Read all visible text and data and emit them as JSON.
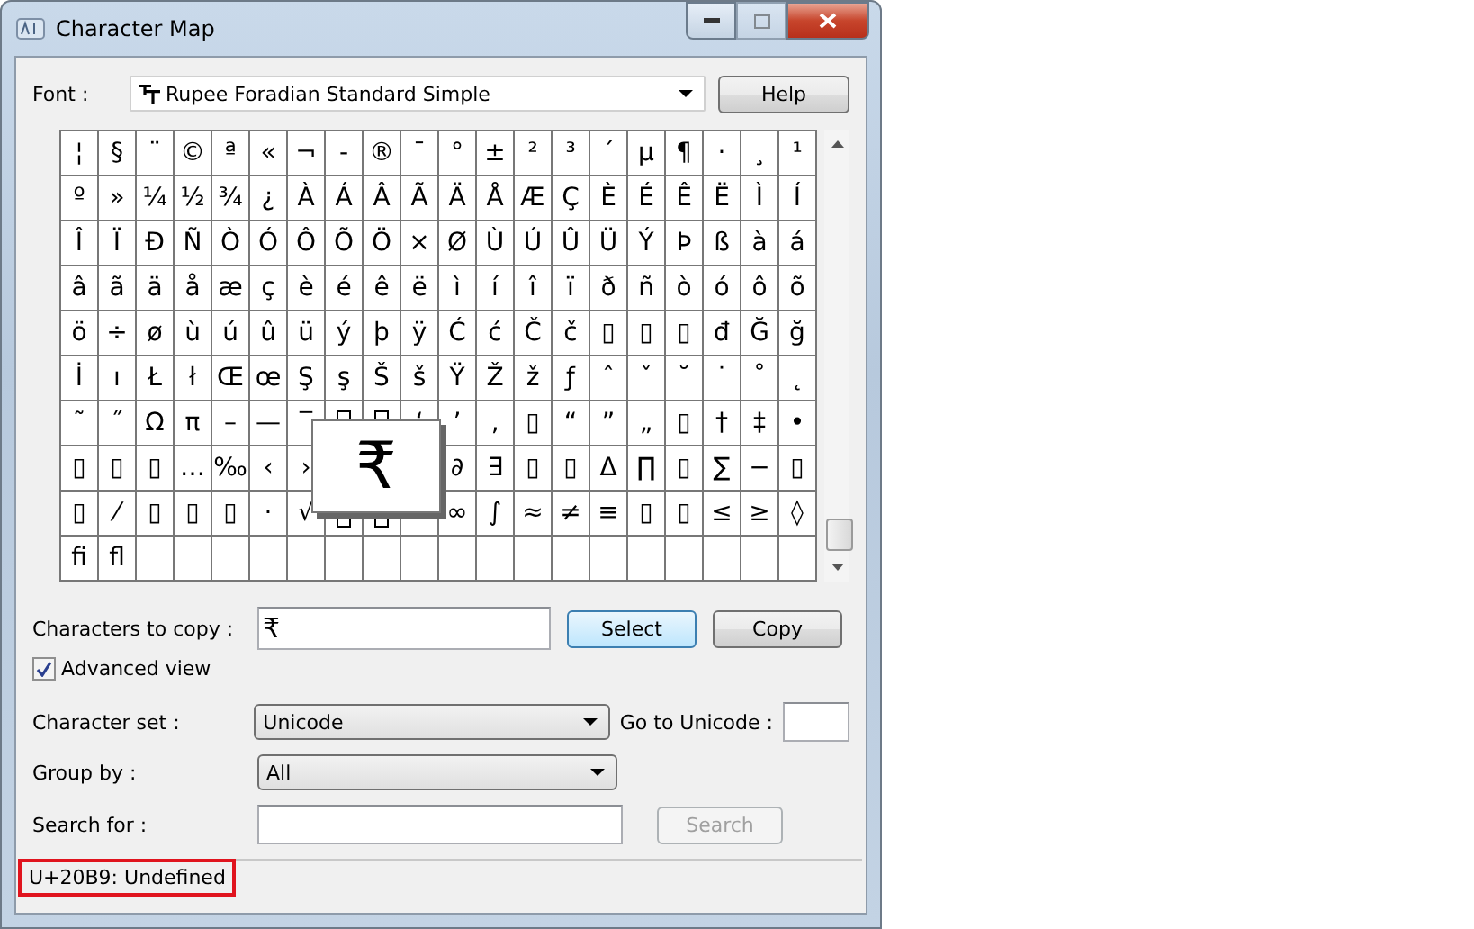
{
  "window": {
    "title": "Character Map",
    "maximize_disabled": true
  },
  "font": {
    "label": "Font :",
    "value": "Rupee Foradian Standard Simple"
  },
  "help_button": "Help",
  "grid": [
    [
      "¦",
      "§",
      "¨",
      "©",
      "ª",
      "«",
      "¬",
      "-",
      "®",
      "¯",
      "°",
      "±",
      "²",
      "³",
      "´",
      "µ",
      "¶",
      "·",
      "¸",
      "¹"
    ],
    [
      "º",
      "»",
      "¼",
      "½",
      "¾",
      "¿",
      "À",
      "Á",
      "Â",
      "Ã",
      "Ä",
      "Å",
      "Æ",
      "Ç",
      "È",
      "É",
      "Ê",
      "Ë",
      "Ì",
      "Í"
    ],
    [
      "Î",
      "Ï",
      "Ð",
      "Ñ",
      "Ò",
      "Ó",
      "Ô",
      "Õ",
      "Ö",
      "×",
      "Ø",
      "Ù",
      "Ú",
      "Û",
      "Ü",
      "Ý",
      "Þ",
      "ß",
      "à",
      "á"
    ],
    [
      "â",
      "ã",
      "ä",
      "å",
      "æ",
      "ç",
      "è",
      "é",
      "ê",
      "ë",
      "ì",
      "í",
      "î",
      "ï",
      "ð",
      "ñ",
      "ò",
      "ó",
      "ô",
      "õ"
    ],
    [
      "ö",
      "÷",
      "ø",
      "ù",
      "ú",
      "û",
      "ü",
      "ý",
      "þ",
      "ÿ",
      "Ć",
      "ć",
      "Č",
      "č",
      "▯",
      "▯",
      "▯",
      "đ",
      "Ğ",
      "ğ"
    ],
    [
      "İ",
      "ı",
      "Ł",
      "ł",
      "Œ",
      "œ",
      "Ş",
      "ş",
      "Š",
      "š",
      "Ÿ",
      "Ž",
      "ž",
      "ƒ",
      "ˆ",
      "ˇ",
      "˘",
      "˙",
      "˚",
      "˛"
    ],
    [
      "˜",
      "˝",
      "Ω",
      "π",
      "–",
      "—",
      "‾",
      {
        "kind": "glyph_top"
      },
      {
        "kind": "glyph_top"
      },
      "‘",
      "’",
      "‚",
      "▯",
      "“",
      "”",
      "„",
      "▯",
      "†",
      "‡",
      "•"
    ],
    [
      "▯",
      "▯",
      "▯",
      "…",
      "‰",
      "‹",
      "›",
      {
        "kind": "covered"
      },
      {
        "kind": "covered"
      },
      {
        "kind": "covered"
      },
      "∂",
      "∃",
      "▯",
      "▯",
      "Δ",
      "∏",
      "▯",
      "∑",
      "−",
      "▯"
    ],
    [
      "▯",
      "⁄",
      "▯",
      "▯",
      "▯",
      "·",
      "√",
      {
        "kind": "glyph_bottom"
      },
      {
        "kind": "glyph_bottom"
      },
      {
        "kind": "blank"
      },
      "∞",
      "∫",
      "≈",
      "≠",
      "≡",
      "▯",
      "▯",
      "≤",
      "≥",
      "◊"
    ],
    [
      "ﬁ",
      "ﬂ"
    ]
  ],
  "magnified": "₹",
  "copy": {
    "label": "Characters to copy :",
    "value": "₹",
    "buttons": [
      {
        "label": "Select",
        "focused": true
      },
      {
        "label": "Copy",
        "focused": false
      }
    ]
  },
  "advanced_view": {
    "label": "Advanced view",
    "checked": true
  },
  "character_set": {
    "label": "Character set :",
    "value": "Unicode"
  },
  "goto_unicode": {
    "label": "Go to Unicode :"
  },
  "group_by": {
    "label": "Group by :",
    "value": "All"
  },
  "search": {
    "label": "Search for :",
    "button": "Search",
    "button_disabled": true
  },
  "status_bar": {
    "text": "U+20B9: Undefined",
    "highlighted": true
  }
}
